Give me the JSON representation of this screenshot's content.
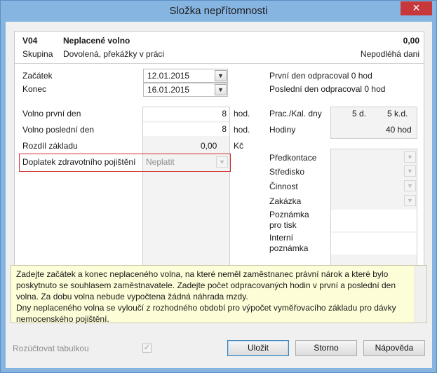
{
  "window": {
    "title": "Složka nepřítomnosti",
    "close_glyph": "✕"
  },
  "header": {
    "code": "V04",
    "name": "Neplacené volno",
    "amount": "0,00",
    "group_label": "Skupina",
    "group_value": "Dovolená, překážky v práci",
    "tax_status": "Nepodléhá dani"
  },
  "dates": {
    "start_label": "Začátek",
    "start_value": "12.01.2015",
    "end_label": "Konec",
    "end_value": "16.01.2015",
    "first_day_worked": "První den odpracoval 0 hod",
    "last_day_worked": "Poslední den odpracoval 0 hod"
  },
  "hours": {
    "first_day_label": "Volno první den",
    "first_day_value": "8",
    "first_day_unit": "hod.",
    "last_day_label": "Volno poslední den",
    "last_day_value": "8",
    "last_day_unit": "hod.",
    "diff_label": "Rozdíl základu",
    "diff_value": "0,00",
    "diff_unit": "Kč",
    "insurance_label": "Doplatek zdravotního pojištění",
    "insurance_value": "Neplatit"
  },
  "summary": {
    "days_label": "Prac./Kal. dny",
    "work_days": "5 d.",
    "cal_days": "5 k.d.",
    "hours_label": "Hodiny",
    "hours_value": "40 hod"
  },
  "accounting": {
    "precontation_label": "Předkontace",
    "center_label": "Středisko",
    "activity_label": "Činnost",
    "order_label": "Zakázka",
    "print_note_label_1": "Poznámka",
    "print_note_label_2": "pro tisk",
    "internal_note_label_1": "Interní",
    "internal_note_label_2": "poznámka"
  },
  "hint": {
    "lines": [
      "Zadejte začátek a konec neplaceného volna, na které neměl zaměstnanec právní nárok a které bylo",
      "poskytnuto se souhlasem zaměstnavatele. Zadejte počet odpracovaných hodin v první a poslední den",
      "volna. Za dobu volna nebude vypočtena žádná náhrada mzdy.",
      "Dny neplaceného volna se vyloučí z rozhodného období pro výpočet vyměřovacího základu pro dávky",
      "nemocenského pojištění."
    ]
  },
  "footer": {
    "allocate_label": "Rozúčtovat tabulkou",
    "save_label": "Uložit",
    "cancel_label": "Storno",
    "help_label": "Nápověda"
  },
  "colors": {
    "title_bar": "#87b5e2",
    "close_button": "#c7383b",
    "hint_bg": "#fdfdd8",
    "highlight_frame": "#d42a2a"
  }
}
